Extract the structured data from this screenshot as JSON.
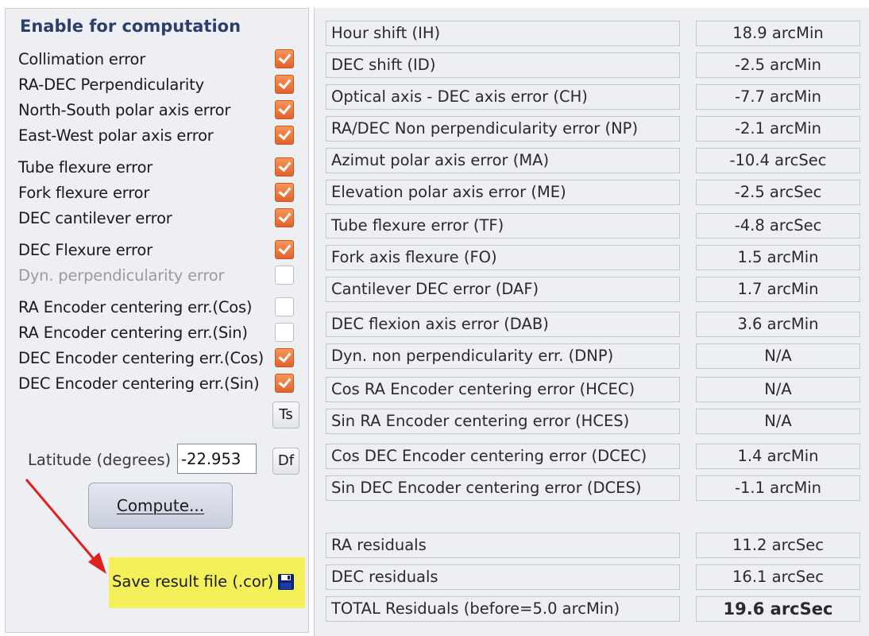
{
  "options": {
    "heading": "Enable for computation",
    "items": [
      {
        "label": "Collimation error",
        "checked": true
      },
      {
        "label": "RA-DEC Perpendicularity",
        "checked": true
      },
      {
        "label": "North-South polar axis error",
        "checked": true
      },
      {
        "label": "East-West polar axis error",
        "checked": true
      },
      {
        "label": "Tube flexure error",
        "checked": true
      },
      {
        "label": "Fork flexure error",
        "checked": true
      },
      {
        "label": "DEC cantilever error",
        "checked": true
      },
      {
        "label": "DEC Flexure error",
        "checked": true
      },
      {
        "label": "Dyn. perpendicularity error",
        "checked": false,
        "disabled": true
      },
      {
        "label": "RA Encoder centering err.(Cos)",
        "checked": false
      },
      {
        "label": "RA Encoder centering err.(Sin)",
        "checked": false
      },
      {
        "label": "DEC Encoder centering err.(Cos)",
        "checked": true
      },
      {
        "label": "DEC Encoder centering err.(Sin)",
        "checked": true
      }
    ],
    "ts_label": "Ts"
  },
  "latitude": {
    "label": "Latitude (degrees) :",
    "value": "-22.953",
    "df_label": "Df"
  },
  "compute_label": "Compute...",
  "save_label": "Save result file (.cor)",
  "results": [
    {
      "label": "Hour shift (IH)",
      "value": "18.9 arcMin"
    },
    {
      "label": "DEC shift (ID)",
      "value": "-2.5 arcMin"
    },
    {
      "label": "Optical axis - DEC axis error (CH)",
      "value": "-7.7 arcMin"
    },
    {
      "label": "RA/DEC Non perpendicularity error (NP)",
      "value": "-2.1 arcMin"
    },
    {
      "label": "Azimut polar axis error (MA)",
      "value": "-10.4 arcSec"
    },
    {
      "label": "Elevation polar axis error (ME)",
      "value": "-2.5 arcSec"
    },
    {
      "label": "Tube flexure error (TF)",
      "value": "-4.8 arcSec"
    },
    {
      "label": "Fork axis flexure (FO)",
      "value": "1.5 arcMin"
    },
    {
      "label": "Cantilever DEC error (DAF)",
      "value": "1.7 arcMin"
    },
    {
      "label": "DEC flexion axis error (DAB)",
      "value": "3.6 arcMin"
    },
    {
      "label": "Dyn. non perpendicularity err. (DNP)",
      "value": "N/A"
    },
    {
      "label": "Cos RA Encoder centering error (HCEC)",
      "value": "N/A"
    },
    {
      "label": "Sin RA Encoder centering error (HCES)",
      "value": "N/A"
    },
    {
      "label": "Cos DEC Encoder centering error (DCEC)",
      "value": "1.4 arcMin"
    },
    {
      "label": "Sin DEC Encoder centering error (DCES)",
      "value": "-1.1 arcMin"
    }
  ],
  "residuals": [
    {
      "label": "RA residuals",
      "value": "11.2 arcSec"
    },
    {
      "label": "DEC residuals",
      "value": "16.1 arcSec"
    },
    {
      "label": "TOTAL Residuals (before=5.0 arcMin)",
      "value": "19.6 arcSec",
      "bold": true
    }
  ],
  "colors": {
    "checkbox_checked": "#e4622a",
    "highlight": "#f3f05a",
    "arrow": "#e02020"
  }
}
